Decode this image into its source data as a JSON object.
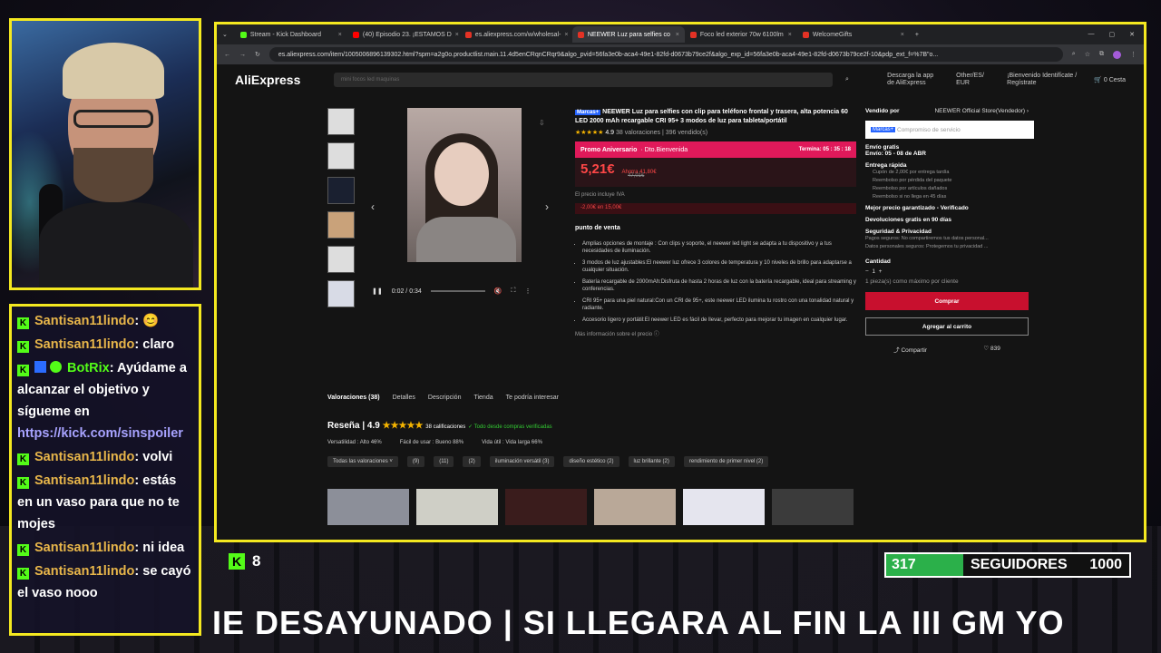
{
  "chat": [
    {
      "user": "Santisan11lindo",
      "text": ": 😊"
    },
    {
      "user": "Santisan11lindo",
      "text": ": claro"
    },
    {
      "user": "BotRix",
      "text": ": Ayúdame a alcanzar el objetivo y sígueme en"
    },
    {
      "user": "",
      "text": "https://kick.com/sinspoiler"
    },
    {
      "user": "Santisan11lindo",
      "text": ": volvi"
    },
    {
      "user": "Santisan11lindo",
      "text": ": estás en un vaso para que no te mojes"
    },
    {
      "user": "Santisan11lindo",
      "text": ": ni idea"
    },
    {
      "user": "Santisan11lindo",
      "text": ": se cayó el vaso nooo"
    }
  ],
  "browser": {
    "tabs": [
      {
        "label": "Stream - Kick Dashboard",
        "color": "#53fc18"
      },
      {
        "label": "(40) Episodio 23. ¡ESTAMOS D",
        "color": "#ff0000"
      },
      {
        "label": "es.aliexpress.com/w/wholesal-",
        "color": "#e43225"
      },
      {
        "label": "NEEWER Luz para selfies co",
        "color": "#e43225"
      },
      {
        "label": "Foco led exterior 70w 6100lm",
        "color": "#e43225"
      },
      {
        "label": "WelcomeGifts",
        "color": "#e43225"
      }
    ],
    "url": "es.aliexpress.com/item/1005006896139302.html?spm=a2g0o.productlist.main.11.4d5enCRqnCRqr9&algo_pvid=56fa3e0b-aca4-49e1-82fd-d0673b79ce2f&algo_exp_id=56fa3e0b-aca4-49e1-82fd-d0673b79ce2f-10&pdp_ext_f=%7B\"o..."
  },
  "ae": {
    "logo": "AliExpress",
    "search_placeholder": "mini focos led maquinas",
    "app": "Descarga la app de AliExpress",
    "region": "Other/ES/ EUR",
    "account": "¡Bienvenido Identifícate / Regístrate",
    "cart": "Cesta",
    "cart_count": "0"
  },
  "video": {
    "time": "0:02 / 0:34"
  },
  "product": {
    "tag": "Marcas+",
    "title": "NEEWER Luz para selfies con clip para teléfono frontal y trasera, alta potencia 60 LED 2000 mAh recargable CRI 95+ 3 modos de luz para tableta/portátil",
    "rating": "4.9",
    "ratings_text": "38 valoraciones | 396 vendido(s)",
    "promo": "Promo Aniversario",
    "promo_sub": "· Dto.Bienvenida",
    "ends": "Termina: 05 : 35 : 18",
    "price": "5,21€",
    "save": "Ahorra 41,80€",
    "old_price": "47,01€",
    "vat": "El precio incluye IVA",
    "coupon": "-2,00€ en 15,00€",
    "highlights_title": "punto de venta",
    "highlights": [
      "Amplias opciones de montaje : Con clips y soporte, el neewer led light se adapta a tu dispositivo y a tus necesidades de iluminación.",
      "3 modos de luz ajustables:El neewer luz ofrece 3 colores de temperatura y 10 niveles de brillo para adaptarse a cualquier situación.",
      "Batería recargable de 2000mAh:Disfruta de hasta 2 horas de luz con la batería recargable, ideal para streaming y conferencias.",
      "CRI 95+ para una piel natural:Con un CRI de 95+, este neewer LED ilumina tu rostro con una tonalidad natural y radiante.",
      "Accesorio ligero y portátil:El neewer LED es fácil de llevar, perfecto para mejorar tu imagen en cualquier lugar."
    ],
    "more_price": "Más información sobre el precio ⓘ"
  },
  "side": {
    "sold_by": "Vendido por",
    "store": "NEEWER Official Store(Vendedor) ›",
    "brand_tag": "Marcas+",
    "brand_text": "Compromiso de servicio",
    "shipping": "Envío gratis",
    "shipping_date": "Envío: 05 - 08 de ABR",
    "fast": "Entrega rápida",
    "fast_items": [
      "Cupón de 2,00€ por entrega tardía",
      "Reembolso por pérdida del paquete",
      "Reembolso por artículos dañados",
      "Reembolso si no llega en 45 días"
    ],
    "guaranteed": "Mejor precio garantizado - Verificado",
    "returns": "Devoluciones gratis en 90 días",
    "security": "Seguridad & Privacidad",
    "security_items": [
      "Pagos seguros: No compartiremos tus datos personal...",
      "Datos personales seguros: Protegemos tu privacidad ..."
    ],
    "qty_label": "Cantidad",
    "qty": "1",
    "qty_note": "1 pieza(s) como máximo por cliente",
    "buy": "Comprar",
    "cart": "Agregar al carrito",
    "share": "Compartir",
    "likes": "839"
  },
  "lower": {
    "tabs": [
      "Valoraciones (38)",
      "Detalles",
      "Descripción",
      "Tienda",
      "Te podría interesar"
    ],
    "review_title": "Reseña | 4.9",
    "review_count": "38 calificaciones",
    "verified": "✓ Todo desde compras verificadas",
    "bars": [
      "Versatilidad : Alto  46%",
      "Fácil de usar : Bueno  88%",
      "Vida útil : Vida larga  66%"
    ],
    "chips": [
      "Todas las valoraciones ˅",
      "(9)",
      "(11)",
      "(2)",
      "iluminación versátil (3)",
      "diseño estético (2)",
      "luz brillante (2)",
      "rendimiento de primer nivel (2)"
    ]
  },
  "stream": {
    "viewers": "8",
    "followers": "317",
    "followers_label": "SEGUIDORES",
    "followers_goal": "1000",
    "follower_progress": 0.317,
    "ticker": "IE DESAYUNADO | SI LLEGARA AL FIN LA III GM YO"
  }
}
